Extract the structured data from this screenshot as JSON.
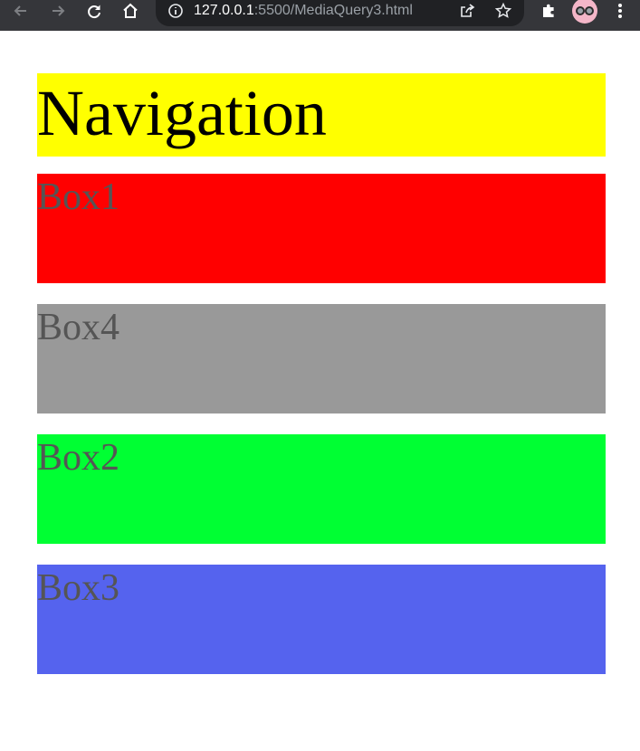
{
  "browser": {
    "url_host": "127.0.0.1",
    "url_path": ":5500/MediaQuery3.html",
    "icons": [
      "back-arrow-icon",
      "forward-arrow-icon",
      "reload-icon",
      "home-icon",
      "info-icon",
      "share-icon",
      "star-icon",
      "extensions-icon",
      "profile-avatar",
      "menu-icon"
    ]
  },
  "page": {
    "navigation": {
      "label": "Navigation",
      "color": "#ffff00"
    },
    "boxes": [
      {
        "label": "Box1",
        "color": "#ff0000"
      },
      {
        "label": "Box4",
        "color": "#999999"
      },
      {
        "label": "Box2",
        "color": "#00ff33"
      },
      {
        "label": "Box3",
        "color": "#5563ee"
      }
    ]
  }
}
